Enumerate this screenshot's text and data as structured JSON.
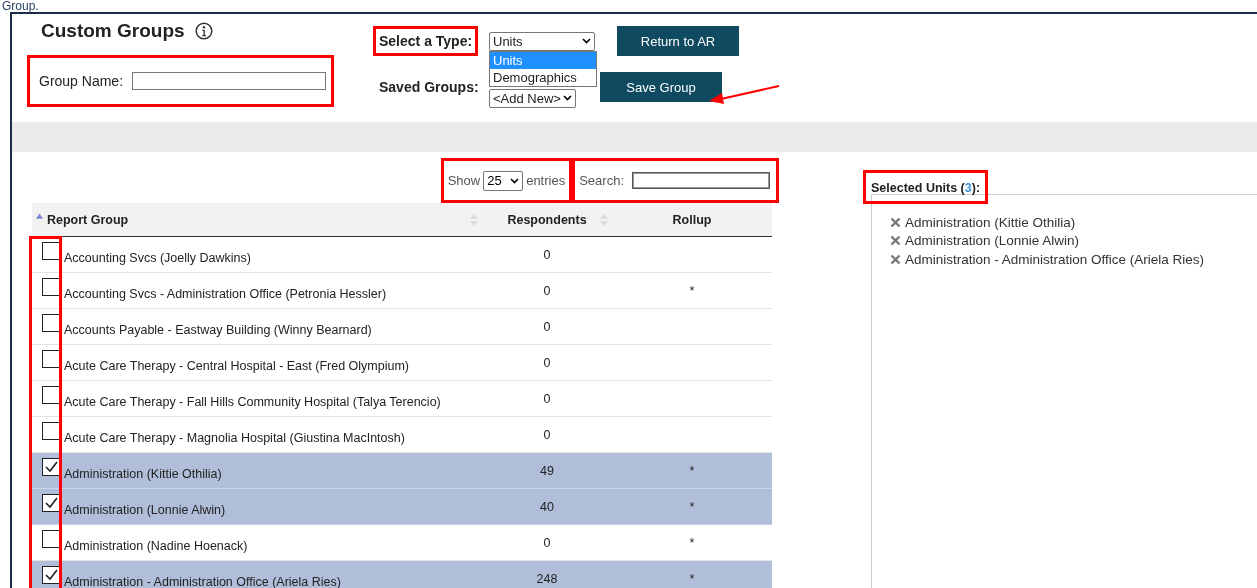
{
  "page_heading": "Group.",
  "title": "Custom Groups",
  "group_name": {
    "label": "Group Name:"
  },
  "type_select": {
    "label": "Select a Type:",
    "value": "Units",
    "expanded": true,
    "options": [
      {
        "label": "Units",
        "selected": true
      },
      {
        "label": "Demographics",
        "selected": false
      }
    ]
  },
  "saved_groups": {
    "label": "Saved Groups:",
    "value": "<Add New>"
  },
  "buttons": [
    "Return to AR",
    "Save Group"
  ],
  "table": {
    "show_label": "Show",
    "page_size": "25",
    "entries_label": "entries",
    "search_label": "Search:",
    "columns": [
      {
        "label": "Report Group",
        "sortable": true,
        "sorted_ascending": true
      },
      {
        "label": "Respondents",
        "sortable": true,
        "sorted_ascending": false
      },
      {
        "label": "Rollup",
        "sortable": false,
        "sorted_ascending": false
      }
    ],
    "rows": [
      {
        "name": "Accounting Svcs (Joelly Dawkins)",
        "respondents": "0",
        "checked": false
      },
      {
        "name": "Accounting Svcs - Administration Office (Petronia Hessler)",
        "respondents": "0",
        "rollup": "*",
        "checked": false
      },
      {
        "name": "Accounts Payable - Eastway Building (Winny Bearnard)",
        "respondents": "0",
        "checked": false
      },
      {
        "name": "Acute Care Therapy - Central Hospital - East (Fred Olympium)",
        "respondents": "0",
        "checked": false
      },
      {
        "name": "Acute Care Therapy - Fall Hills Community Hospital (Talya Terencio)",
        "respondents": "0",
        "checked": false
      },
      {
        "name": "Acute Care Therapy - Magnolia Hospital (Giustina MacIntosh)",
        "respondents": "0",
        "checked": false
      },
      {
        "name": "Administration (Kittie Othilia)",
        "respondents": "49",
        "rollup": "*",
        "checked": true
      },
      {
        "name": "Administration (Lonnie Alwin)",
        "respondents": "40",
        "rollup": "*",
        "checked": true
      },
      {
        "name": "Administration (Nadine Hoenack)",
        "respondents": "0",
        "rollup": "*",
        "checked": false
      },
      {
        "name": "Administration - Administration Office (Ariela Ries)",
        "respondents": "248",
        "rollup": "*",
        "checked": true
      }
    ]
  },
  "selected_panel": {
    "title": "Selected Units (",
    "count": "3",
    "title_end": "):",
    "items": [
      "Administration (Kittie Othilia)",
      "Administration (Lonnie Alwin)",
      "Administration - Administration Office (Ariela Ries)"
    ]
  }
}
